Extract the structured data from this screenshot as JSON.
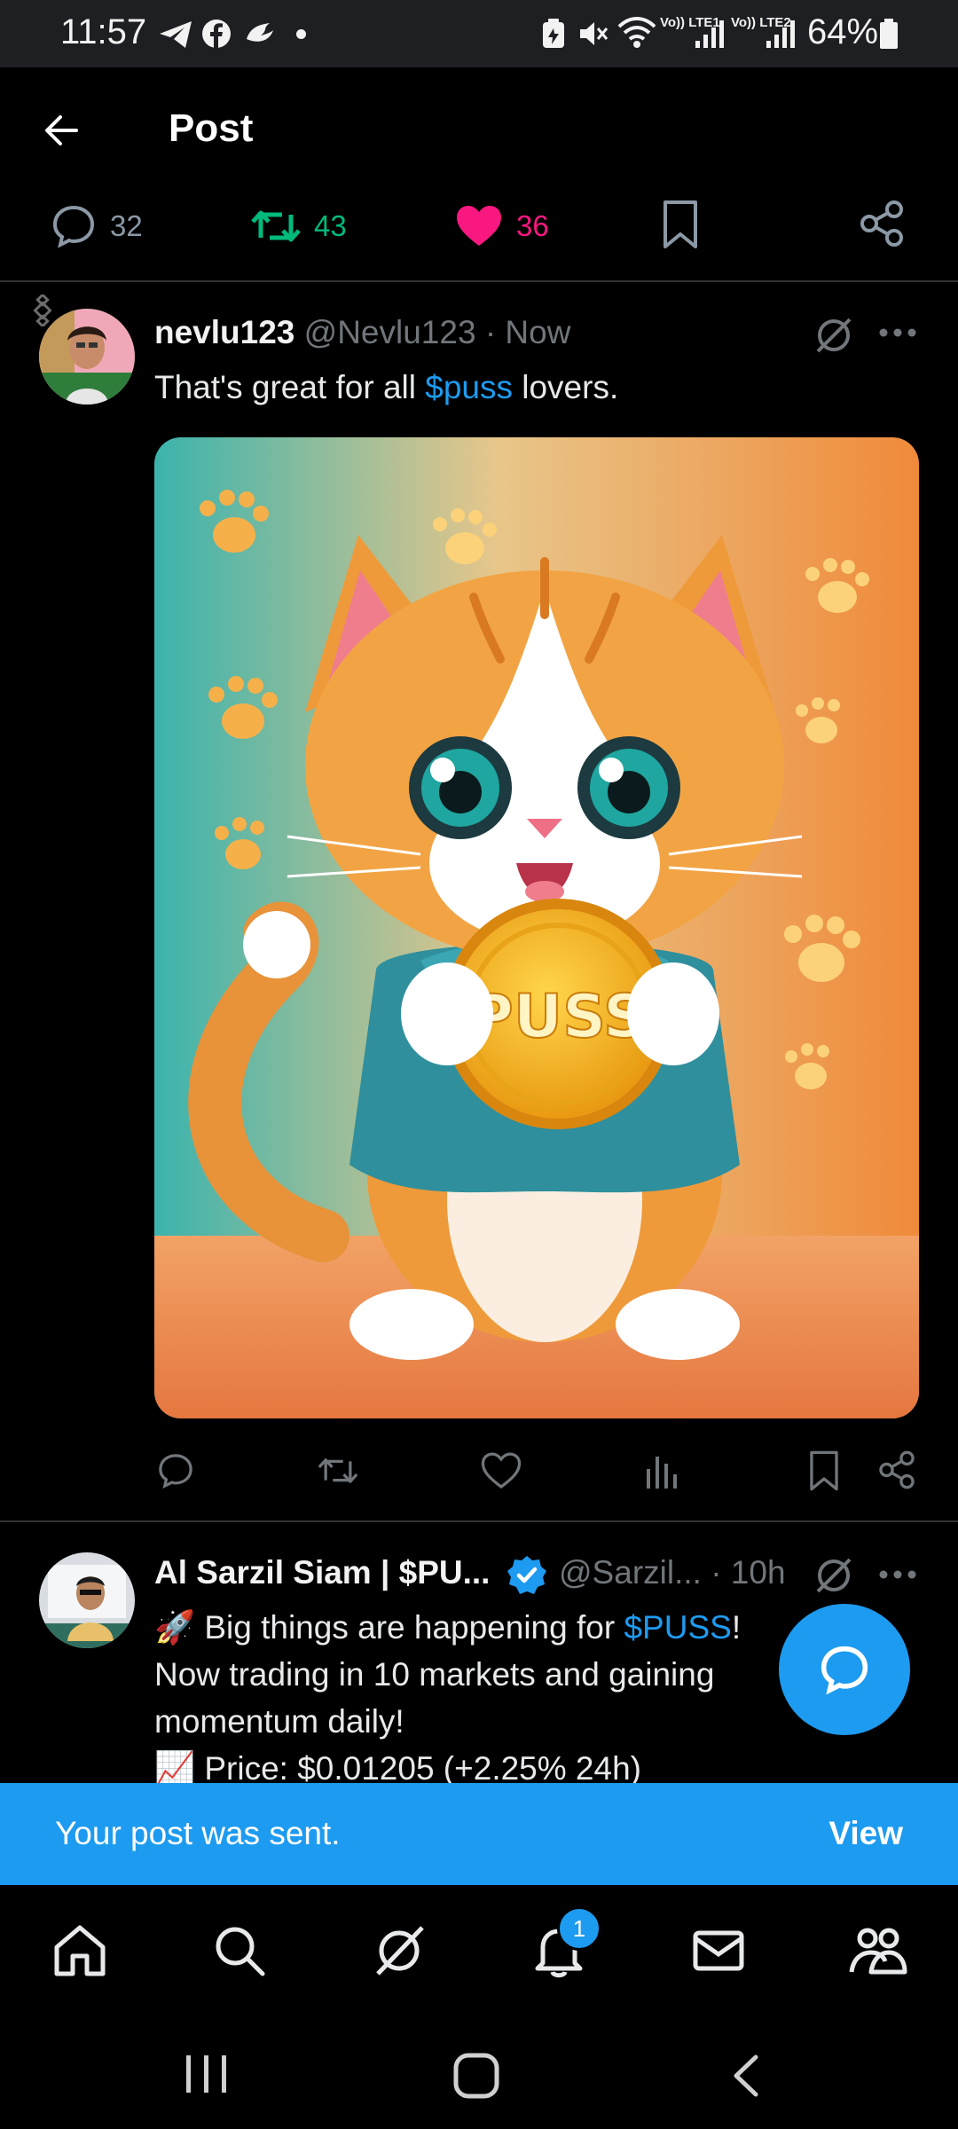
{
  "status_bar": {
    "time": "11:57",
    "battery": "64%",
    "network_labels": [
      "Vo)) LTE1",
      "Vo)) LTE2"
    ]
  },
  "header": {
    "title": "Post",
    "stats": {
      "replies": "32",
      "reposts": "43",
      "likes": "36"
    }
  },
  "tweets": [
    {
      "name": "nevlu123",
      "handle": "@Nevlu123 · Now",
      "text_before": "That's great for all ",
      "cashtag": "$puss",
      "text_after": " lovers.",
      "media_text": "PUSS"
    },
    {
      "name": "Al Sarzil Siam | $PU...",
      "handle": "@Sarzil... · 10h",
      "lines": [
        {
          "before": "🚀 Big things are happening for ",
          "cashtag": "$PUSS",
          "after": "!"
        },
        {
          "before": "Now trading in 10 markets and gaining",
          "cashtag": "",
          "after": ""
        },
        {
          "before": "momentum daily!",
          "cashtag": "",
          "after": ""
        },
        {
          "before": "📈 Price: $0.01205 (+2.25% 24h)",
          "cashtag": "",
          "after": ""
        }
      ]
    }
  ],
  "toast": {
    "message": "Your post was sent.",
    "action": "View"
  },
  "bottom_nav": {
    "notification_count": "1"
  },
  "colors": {
    "accent": "#1d9bf0",
    "repost": "#00ba7c",
    "like": "#f91880",
    "muted": "#71767b"
  }
}
